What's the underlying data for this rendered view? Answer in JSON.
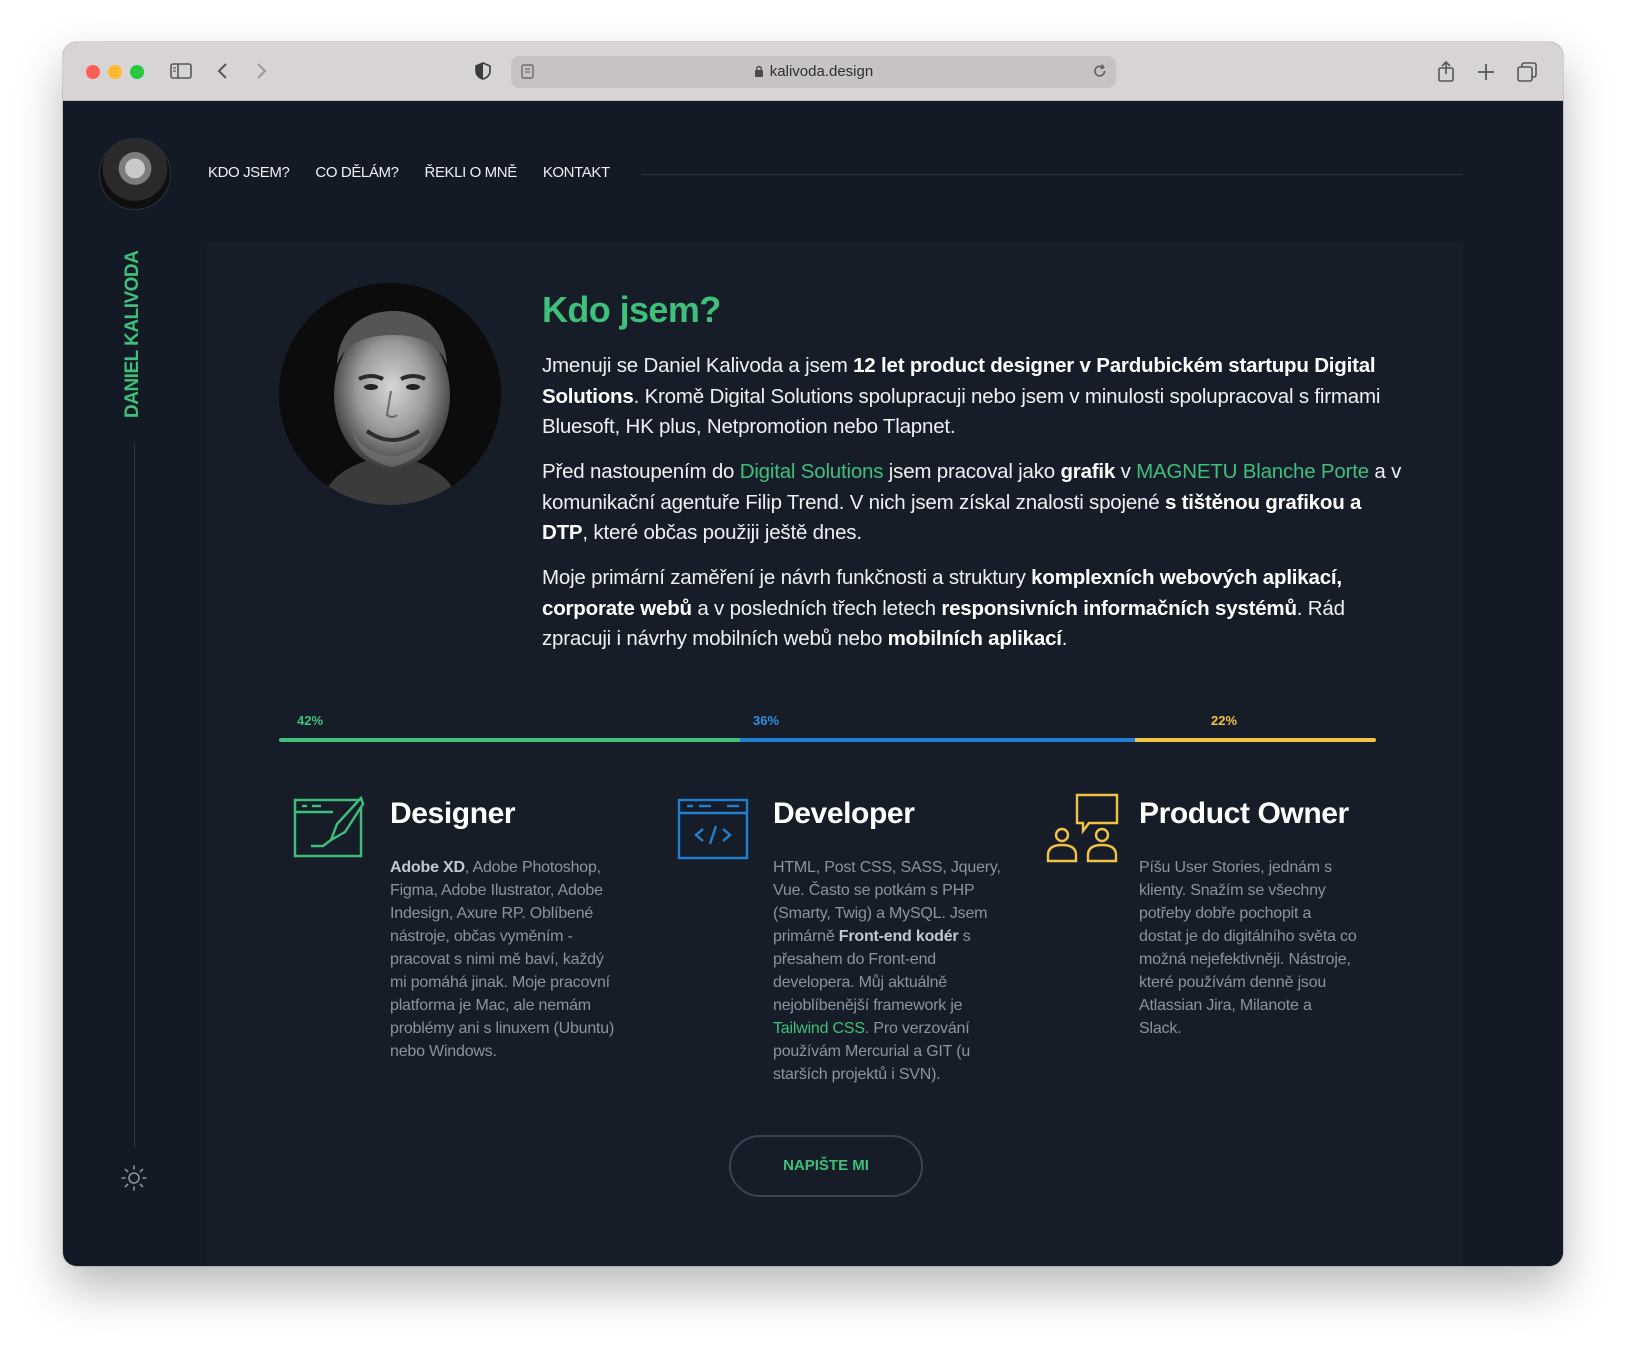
{
  "browser": {
    "url": "kalivoda.design"
  },
  "nav": {
    "items": [
      "KDO JSEM?",
      "CO DĚLÁM?",
      "ŘEKLI O MNĚ",
      "KONTAKT"
    ]
  },
  "sidebar": {
    "name": "DANIEL KALIVODA"
  },
  "about": {
    "heading": "Kdo jsem?",
    "p1": {
      "t1": "Jmenuji se Daniel Kalivoda a jsem ",
      "b1": "12 let product designer v Pardubickém startupu Digital Solutions",
      "t2": ". Kromě Digital Solutions spolupracuji nebo jsem v minulosti spolupracoval s firmami Bluesoft, HK plus, Netpromotion nebo Tlapnet."
    },
    "p2": {
      "t1": "Před nastoupením do ",
      "l1": "Digital Solutions",
      "t2": " jsem pracoval jako ",
      "b1": "grafik",
      "t3": " v ",
      "l2": "MAGNETU Blanche Porte",
      "t4": " a v komunikační agentuře Filip Trend. V nich jsem získal znalosti spojené ",
      "b2": "s tištěnou grafikou a DTP",
      "t5": ", které občas použiji ještě dnes."
    },
    "p3": {
      "t1": "Moje primární zaměření je návrh funkčnosti a struktury ",
      "b1": "komplexních webových aplikací, corporate webů",
      "t2": " a v posledních třech letech ",
      "b2": "responsivních informačních systémů",
      "t3": ". Rád zpracuji i návrhy mobilních webů nebo ",
      "b3": "mobilních aplikací",
      "t4": "."
    }
  },
  "split": {
    "segments": [
      {
        "label": "42%",
        "value": 0.42,
        "color": "#3ec07a"
      },
      {
        "label": "36%",
        "value": 0.36,
        "color": "#1f7fd0"
      },
      {
        "label": "22%",
        "value": 0.22,
        "color": "#f0c245"
      }
    ]
  },
  "roles": {
    "designer": {
      "title": "Designer",
      "b1": "Adobe XD",
      "t1": ", Adobe Photoshop, Figma, Adobe Ilustrator, Adobe Indesign, Axure RP. Oblíbené nástroje, občas vyměním - pracovat s nimi mě baví, každý mi pomáhá jinak. Moje pracovní platforma je Mac, ale nemám problémy ani s linuxem (Ubuntu) nebo Windows.",
      "icon": "design-pen-icon",
      "color": "#3ec07a"
    },
    "developer": {
      "title": "Developer",
      "t1": "HTML, Post CSS, SASS, Jquery, Vue. Často se potkám s PHP (Smarty, Twig) a MySQL. Jsem primárně ",
      "b1": "Front-end kodér",
      "t2": " s přesahem do Front-end developera. Můj aktuálně nejoblíbenější framework je ",
      "l1": "Tailwind CSS",
      "t3": ". Pro verzování používám Mercurial a GIT (u starších projektů i SVN).",
      "icon": "code-window-icon",
      "color": "#1f7fd0"
    },
    "owner": {
      "title": "Product Owner",
      "t1": "Píšu User Stories, jednám s klienty. Snažím se všechny potřeby dobře pochopit a dostat je do digitálního světa co možná nejefektivněji. Nástroje, které používám denně jsou Atlassian Jira, Milanote a Slack.",
      "icon": "people-chat-icon",
      "color": "#f0c245"
    }
  },
  "cta": {
    "label": "NAPIŠTE MI"
  }
}
